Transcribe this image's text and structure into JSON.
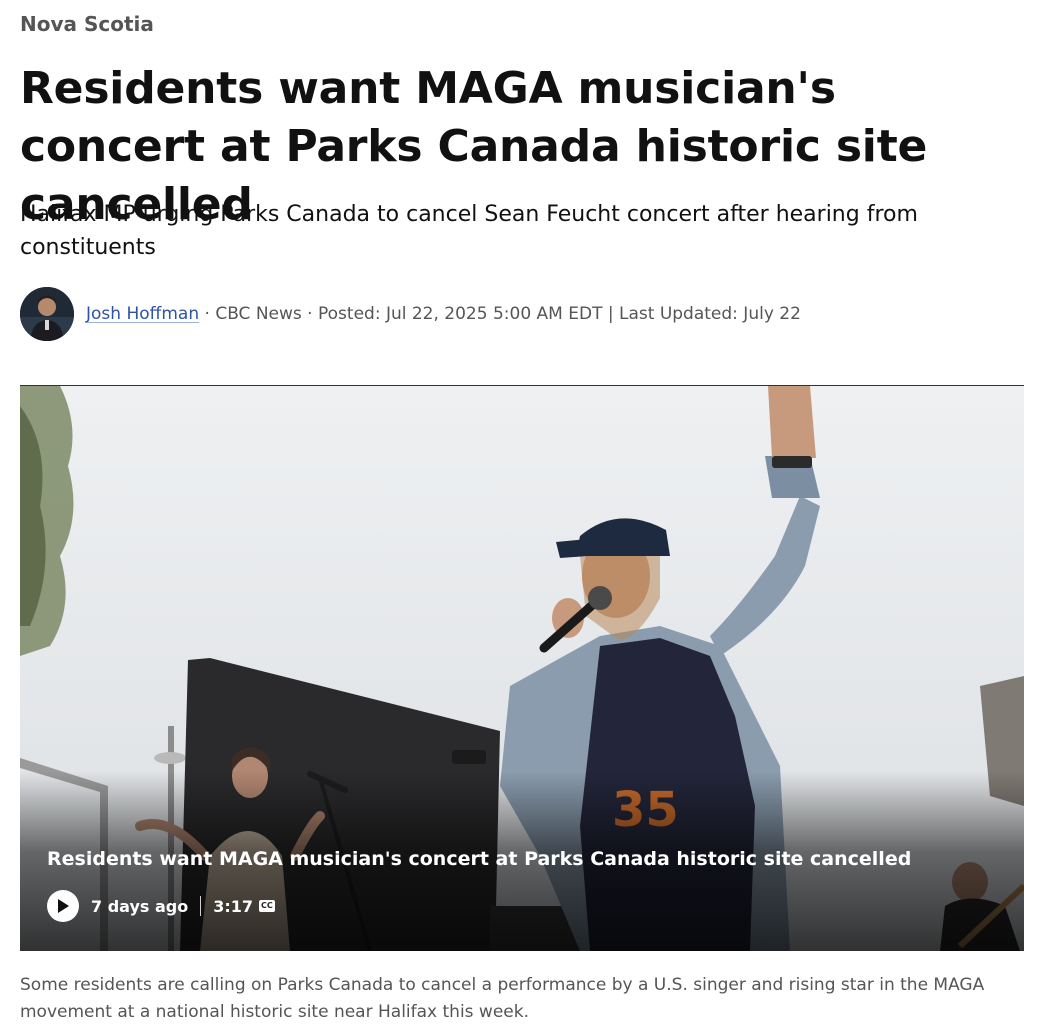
{
  "section": {
    "label": "Nova Scotia"
  },
  "article": {
    "headline": "Residents want MAGA musician's concert at Parks Canada historic site cancelled",
    "deck": "Halifax MP urging Parks Canada to cancel Sean Feucht concert after hearing from constituents"
  },
  "byline": {
    "author": "Josh Hoffman",
    "sep1": " · ",
    "outlet": "CBC News",
    "sep2": " · ",
    "posted": "Posted: Jul 22, 2025 5:00 AM EDT | Last Updated: July 22"
  },
  "video": {
    "title": "Residents want MAGA musician's concert at Parks Canada historic site cancelled",
    "age": "7 days ago",
    "duration": "3:17",
    "cc_label": "CC",
    "play_icon": "play-icon"
  },
  "caption": "Some residents are calling on Parks Canada to cancel a performance by a U.S. singer and rising star in the MAGA movement at a national historic site near Halifax this week.",
  "colors": {
    "link": "#2d53a8",
    "section": "#555555",
    "text": "#111111"
  }
}
